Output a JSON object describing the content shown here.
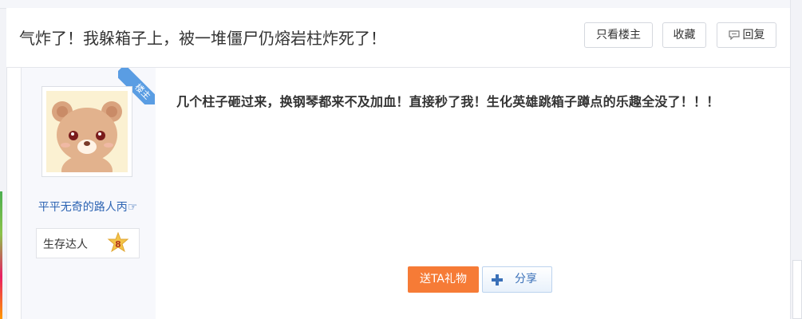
{
  "thread": {
    "title": "气炸了！我躲箱子上，被一堆僵尸仍熔岩柱炸死了！"
  },
  "toolbar": {
    "only_op_label": "只看楼主",
    "favorite_label": "收藏",
    "reply_label": "回复",
    "reply_icon": "comment-icon"
  },
  "author": {
    "op_tag": "楼主",
    "name": "平平无奇的路人丙☞",
    "badge_label": "生存达人",
    "badge_level": "8",
    "avatar_icon": "bear-avatar"
  },
  "post": {
    "content": "几个柱子砸过来，换钢琴都来不及加血！直接秒了我！生化英雄跳箱子蹲点的乐趣全没了！！！"
  },
  "actions": {
    "gift_label": "送TA礼物",
    "share_label": "分享",
    "share_icon": "plus-icon"
  },
  "colors": {
    "gift_button": "#f67b36",
    "username_link": "#2d64b3",
    "op_ribbon": "#5a9de3",
    "badge_star": "#f3c449"
  }
}
